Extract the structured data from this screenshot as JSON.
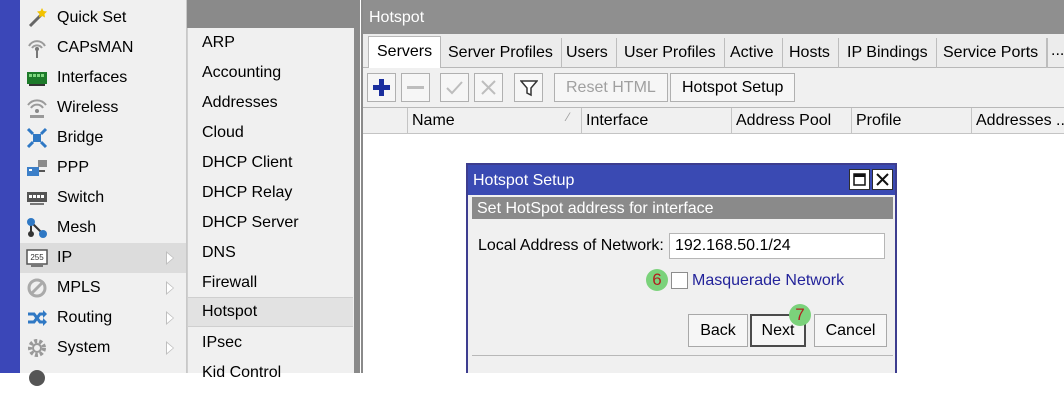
{
  "sidebar": {
    "items": [
      {
        "label": "Quick Set",
        "icon": "magic-wand-icon",
        "has_submenu": false
      },
      {
        "label": "CAPsMAN",
        "icon": "antenna-icon",
        "has_submenu": false
      },
      {
        "label": "Interfaces",
        "icon": "network-card-icon",
        "has_submenu": false
      },
      {
        "label": "Wireless",
        "icon": "wireless-icon",
        "has_submenu": false
      },
      {
        "label": "Bridge",
        "icon": "bridge-icon",
        "has_submenu": false
      },
      {
        "label": "PPP",
        "icon": "ppp-icon",
        "has_submenu": false
      },
      {
        "label": "Switch",
        "icon": "switch-icon",
        "has_submenu": false
      },
      {
        "label": "Mesh",
        "icon": "mesh-icon",
        "has_submenu": false
      },
      {
        "label": "IP",
        "icon": "ip-icon",
        "has_submenu": true,
        "icon_text": "255"
      },
      {
        "label": "MPLS",
        "icon": "mpls-icon",
        "has_submenu": true
      },
      {
        "label": "Routing",
        "icon": "routing-icon",
        "has_submenu": true
      },
      {
        "label": "System",
        "icon": "gear-icon",
        "has_submenu": true
      }
    ]
  },
  "ip_submenu": {
    "items": [
      "ARP",
      "Accounting",
      "Addresses",
      "Cloud",
      "DHCP Client",
      "DHCP Relay",
      "DHCP Server",
      "DNS",
      "Firewall",
      "Hotspot",
      "IPsec",
      "Kid Control"
    ],
    "selected": "Hotspot"
  },
  "hotspot_window": {
    "title": "Hotspot",
    "tabs": [
      "Servers",
      "Server Profiles",
      "Users",
      "User Profiles",
      "Active",
      "Hosts",
      "IP Bindings",
      "Service Ports"
    ],
    "active_tab": "Servers",
    "more_tabs": "...",
    "toolbar": {
      "add_icon": "plus-icon",
      "remove_icon": "minus-icon",
      "enable_icon": "check-icon",
      "disable_icon": "x-icon",
      "filter_icon": "filter-icon",
      "reset_html_label": "Reset HTML",
      "setup_label": "Hotspot Setup"
    },
    "columns": [
      "",
      "Name",
      "Interface",
      "Address Pool",
      "Profile",
      "Addresses ..."
    ]
  },
  "dialog": {
    "title": "Hotspot Setup",
    "section": "Set HotSpot address for interface",
    "local_address_label": "Local Address of Network:",
    "local_address_value": "192.168.50.1/24",
    "masquerade_label": "Masquerade Network",
    "masquerade_checked": false,
    "back_label": "Back",
    "next_label": "Next",
    "cancel_label": "Cancel",
    "maximize_icon": "maximize-icon",
    "close_icon": "close-icon"
  },
  "annotations": {
    "marker_6": "6",
    "marker_7": "7"
  },
  "colors": {
    "accent": "#3a4ab3",
    "left_strip": "#3b47b8",
    "window_title": "#8f8f8f",
    "marker_bg": "#7bd27b",
    "marker_text": "#b21f1f"
  }
}
